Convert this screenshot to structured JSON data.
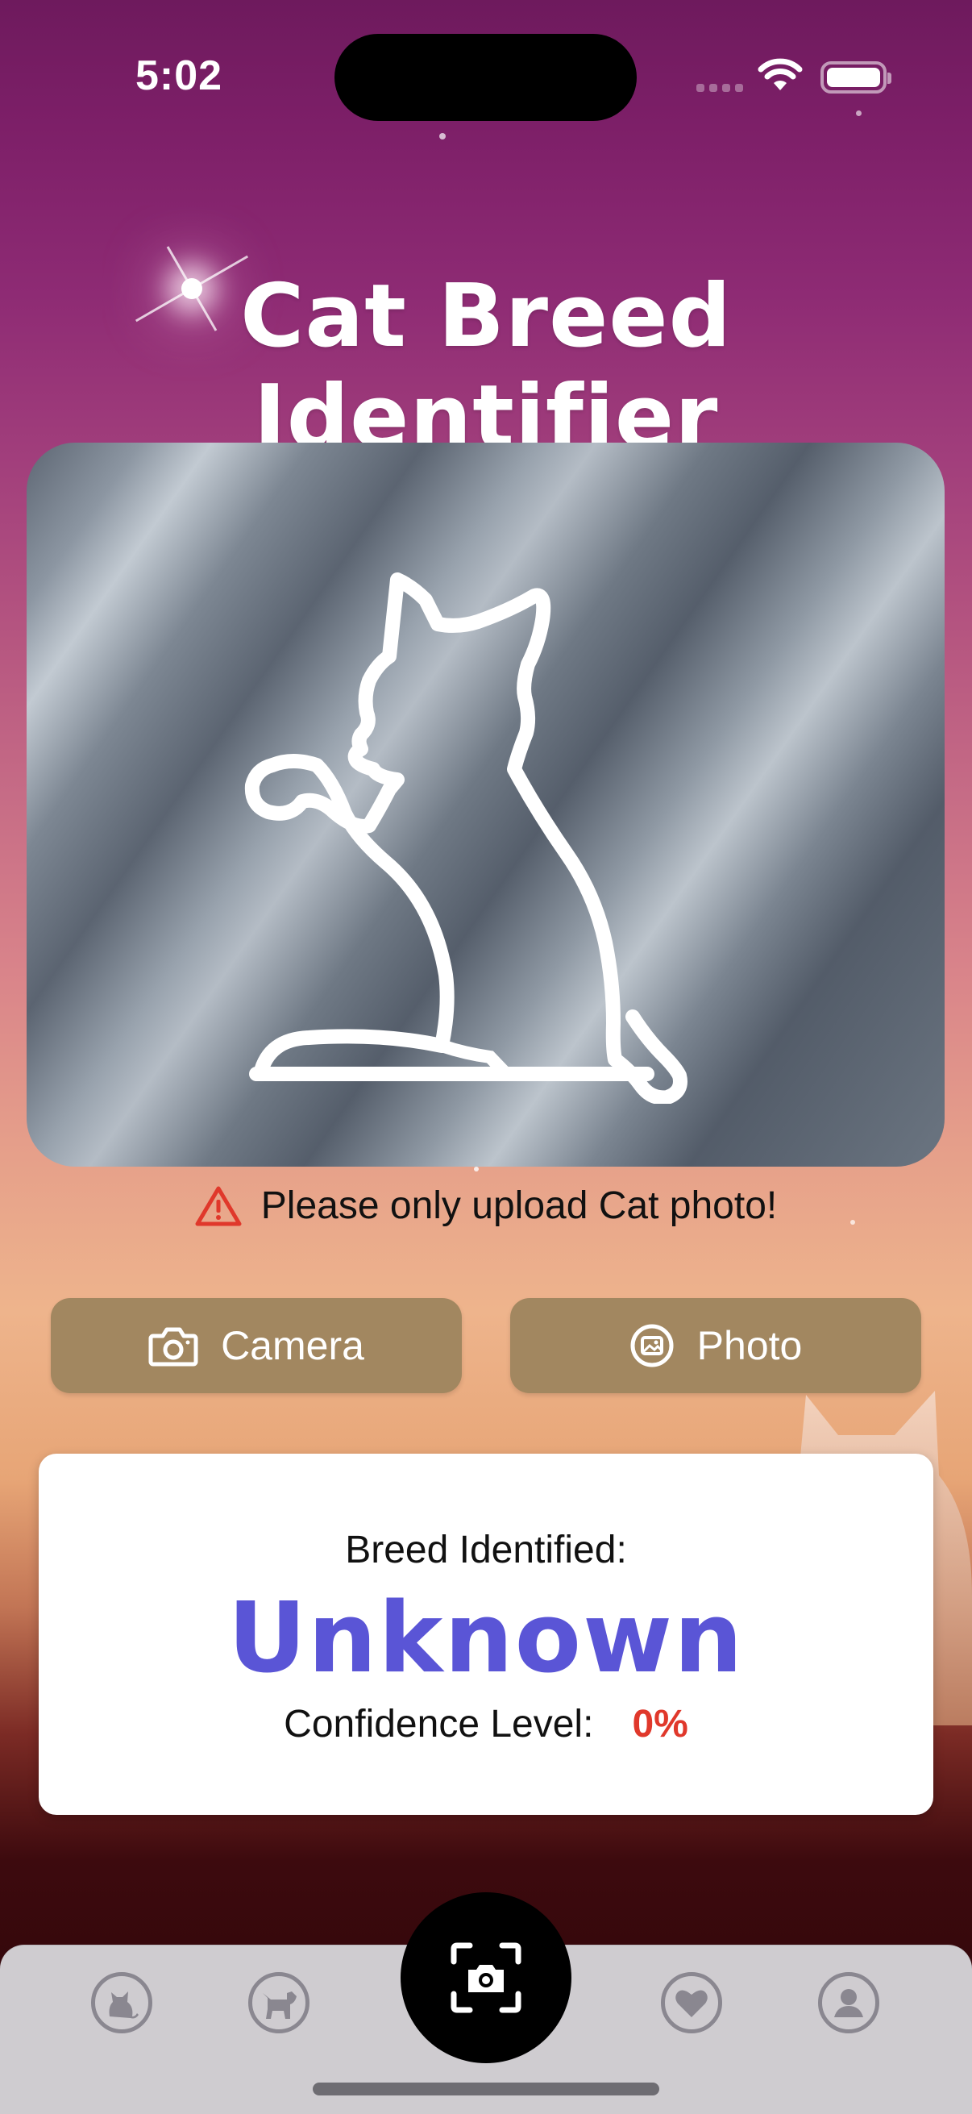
{
  "status_bar": {
    "time": "5:02"
  },
  "app": {
    "title": "Cat Breed Identifier"
  },
  "upload": {
    "warning_text": "Please only upload Cat photo!",
    "warning_icon": "warning-triangle-icon",
    "warning_color": "#e0382b"
  },
  "actions": {
    "camera_label": "Camera",
    "photo_label": "Photo",
    "button_color": "#a28760"
  },
  "result": {
    "breed_label": "Breed Identified:",
    "breed_value": "Unknown",
    "confidence_label": "Confidence Level:",
    "confidence_value": "0%",
    "breed_color": "#5a55d6"
  },
  "tab_bar": {
    "items": [
      {
        "icon": "cat-icon",
        "selected": false
      },
      {
        "icon": "dog-icon",
        "selected": false
      },
      {
        "icon": "scan-camera-icon",
        "selected": true
      },
      {
        "icon": "heart-icon",
        "selected": false
      },
      {
        "icon": "profile-icon",
        "selected": false
      }
    ]
  }
}
